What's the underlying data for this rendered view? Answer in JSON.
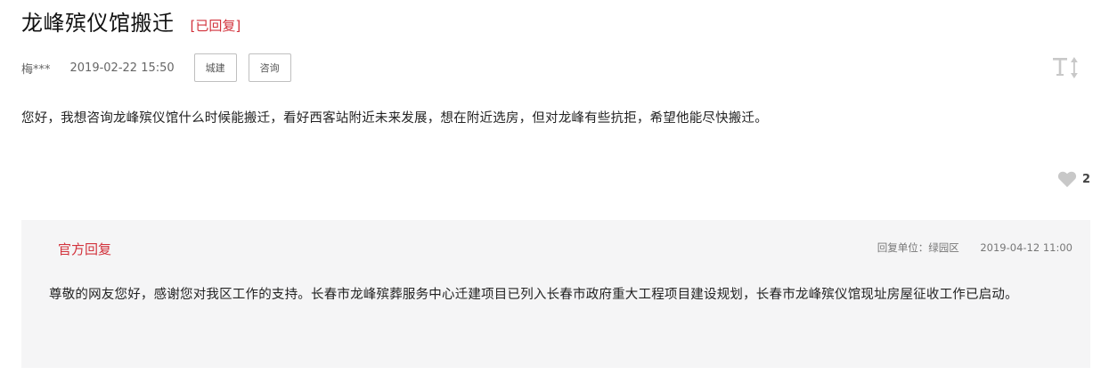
{
  "post": {
    "title": "龙峰殡仪馆搬迁",
    "status": "[已回复]",
    "author": "梅***",
    "date": "2019-02-22 15:50",
    "tags": [
      "城建",
      "咨询"
    ],
    "content": "您好，我想咨询龙峰殡仪馆什么时候能搬迁，看好西客站附近未来发展，想在附近选房，但对龙峰有些抗拒，希望他能尽快搬迁。",
    "like_count": "2"
  },
  "reply": {
    "title": "官方回复",
    "unit": "回复单位：绿园区",
    "date": "2019-04-12 11:00",
    "body": "尊敬的网友您好，感谢您对我区工作的支持。长春市龙峰殡葬服务中心迁建项目已列入长春市政府重大工程项目建设规划，长春市龙峰殡仪馆现址房屋征收工作已启动。"
  },
  "icons": {
    "font_size_toggle": "text-size-icon",
    "like": "heart-icon"
  },
  "colors": {
    "accent": "#d2323c",
    "reply_bg": "#f5f5f6",
    "icon_gray": "#c8c8c8"
  }
}
